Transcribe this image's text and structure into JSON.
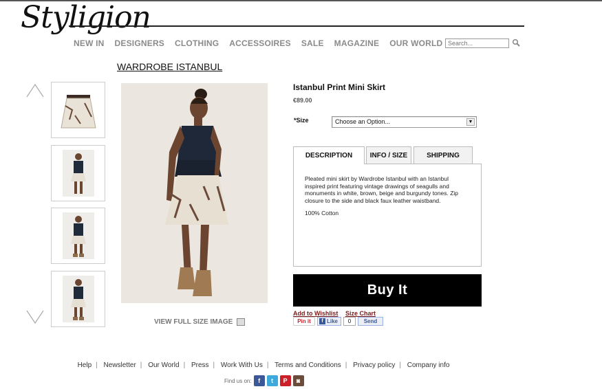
{
  "header": {
    "logo": "Styligion",
    "nav": [
      "NEW IN",
      "DESIGNERS",
      "CLOTHING",
      "ACCESSOIRES",
      "SALE",
      "MAGAZINE",
      "OUR WORLD"
    ],
    "search_placeholder": "Search..."
  },
  "brand": {
    "title": "WARDROBE ISTANBUL"
  },
  "gallery": {
    "view_full": "VIEW FULL SIZE IMAGE"
  },
  "product": {
    "name": "Istanbul Print Mini Skirt",
    "price": "€89.00",
    "size_label": "*Size",
    "size_value": "Choose an Option...",
    "tabs": [
      "DESCRIPTION",
      "INFO / SIZE",
      "SHIPPING"
    ],
    "description": "Pleated mini skirt by Wardrobe Istanbul with an Istanbul inspired print featuring vintage drawings of seagulls and monuments in white, brown, beige and burgundy tones. Zip closure to the side and black faux leather waistband.",
    "material": "100% Cotton",
    "buy": "Buy It",
    "wishlist": "Add to Wishlist",
    "size_chart": "Size Chart"
  },
  "share": {
    "pin": "Pin it",
    "like": "Like",
    "count": "0",
    "send": "Send"
  },
  "footer": {
    "links": [
      "Help",
      "Newsletter",
      "Our World",
      "Press",
      "Work With Us",
      "Terms and Conditions",
      "Privacy policy",
      "Company info"
    ],
    "find": "Find us on:"
  }
}
